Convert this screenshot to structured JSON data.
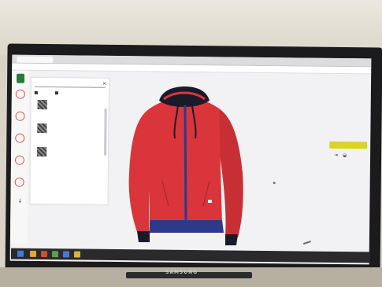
{
  "browser": {
    "tab_label": "",
    "address": ""
  },
  "left_panel": {
    "search_placeholder": "",
    "close_icon": "close-icon",
    "checkbox_1": "",
    "checkbox_2": "",
    "items": [
      {
        "text": ""
      },
      {
        "text": ""
      },
      {
        "text": ""
      }
    ]
  },
  "right_panel": {
    "heading": "",
    "rows": [
      {
        "label": "",
        "value": ""
      },
      {
        "label": "",
        "value": ""
      },
      {
        "label": "",
        "value": ""
      },
      {
        "label": "",
        "value": ""
      }
    ],
    "cta_label": ""
  },
  "rail": {
    "items": [
      {
        "icon": "red-circle-icon"
      },
      {
        "icon": "red-circle-icon"
      },
      {
        "icon": "red-circle-icon"
      },
      {
        "icon": "red-circle-icon"
      },
      {
        "icon": "red-circle-icon"
      },
      {
        "icon": "arrow-down-icon"
      }
    ]
  },
  "monitor": {
    "brand": "SAMSUNG"
  },
  "colors": {
    "jacket": "#d9353b",
    "zipper_trim": "#2d3a8c",
    "hood_lining": "#1a1a2a",
    "cta": "#d9d32a",
    "accent_red": "#d95a4a"
  }
}
